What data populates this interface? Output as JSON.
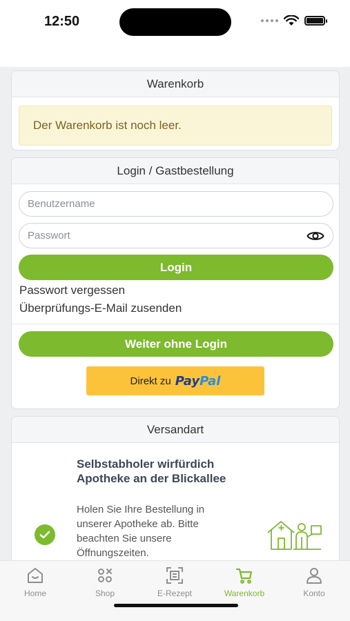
{
  "status_bar": {
    "time": "12:50"
  },
  "cart": {
    "header": "Warenkorb",
    "empty_message": "Der Warenkorb ist noch leer."
  },
  "login": {
    "header": "Login / Gastbestellung",
    "username_placeholder": "Benutzername",
    "password_placeholder": "Passwort",
    "login_button": "Login",
    "forgot_password": "Passwort vergessen",
    "verification_email": "Überprüfungs-E-Mail zusenden",
    "guest_button": "Weiter ohne Login",
    "paypal_prefix": "Direkt zu",
    "paypal_pay": "Pay",
    "paypal_pal": "Pal"
  },
  "shipping": {
    "header": "Versandart",
    "option_title": "Selbstabholer wirfürdich Apotheke an der Blickallee",
    "option_description": "Holen Sie Ihre Bestellung in unserer Apotheke ab. Bitte beachten Sie unsere Öffnungszeiten.",
    "selected": true
  },
  "tab_bar": {
    "items": [
      {
        "label": "Home",
        "icon": "home-icon",
        "active": false
      },
      {
        "label": "Shop",
        "icon": "shop-icon",
        "active": false
      },
      {
        "label": "E-Rezept",
        "icon": "prescription-scan-icon",
        "active": false
      },
      {
        "label": "Warenkorb",
        "icon": "cart-icon",
        "active": true
      },
      {
        "label": "Konto",
        "icon": "account-icon",
        "active": false
      }
    ]
  },
  "colors": {
    "accent": "#7dba2d",
    "paypal_yellow": "#fcc33a",
    "empty_notice_bg": "#fbf5d8",
    "empty_notice_text": "#7a6320"
  }
}
